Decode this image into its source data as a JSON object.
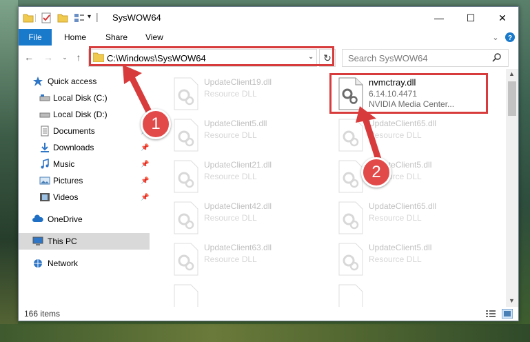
{
  "window": {
    "title": "SysWOW64",
    "controls": {
      "minimize": "—",
      "maximize": "☐",
      "close": "✕"
    }
  },
  "ribbon": {
    "tabs": [
      "File",
      "Home",
      "Share",
      "View"
    ]
  },
  "address_bar": {
    "path": "C:\\Windows\\SysWOW64",
    "refresh_icon": "refresh-icon"
  },
  "search": {
    "placeholder": "Search SysWOW64"
  },
  "sidebar": {
    "items": [
      {
        "label": "Quick access",
        "icon": "star-icon"
      },
      {
        "label": "Local Disk (C:)",
        "icon": "drive-icon"
      },
      {
        "label": "Local Disk (D:)",
        "icon": "drive-icon"
      },
      {
        "label": "Documents",
        "icon": "documents-icon"
      },
      {
        "label": "Downloads",
        "icon": "downloads-icon"
      },
      {
        "label": "Music",
        "icon": "music-icon"
      },
      {
        "label": "Pictures",
        "icon": "pictures-icon"
      },
      {
        "label": "Videos",
        "icon": "videos-icon"
      },
      {
        "label": "OneDrive",
        "icon": "cloud-icon"
      },
      {
        "label": "This PC",
        "icon": "computer-icon"
      },
      {
        "label": "Network",
        "icon": "network-icon"
      }
    ]
  },
  "files": {
    "highlighted": {
      "name": "nvmctray.dll",
      "version": "6.14.10.4471",
      "description": "NVIDIA Media Center..."
    },
    "left_column": [
      {
        "name": "UpdateClient19.dll",
        "type": "Resource DLL"
      },
      {
        "name": "UpdateClient5.dll",
        "type": "Resource DLL"
      },
      {
        "name": "UpdateClient21.dll",
        "type": "Resource DLL"
      },
      {
        "name": "UpdateClient42.dll",
        "type": "Resource DLL"
      },
      {
        "name": "UpdateClient63.dll",
        "type": "Resource DLL"
      }
    ],
    "right_column": [
      {
        "name": "UpdateClient65.dll",
        "type": "Resource DLL"
      },
      {
        "name": "UpdateClient5.dll",
        "type": "Resource DLL"
      },
      {
        "name": "UpdateClient65.dll",
        "type": "Resource DLL"
      },
      {
        "name": "UpdateClient5.dll",
        "type": "Resource DLL"
      }
    ]
  },
  "status": {
    "item_count": "166 items"
  },
  "annotations": {
    "step1": "1",
    "step2": "2",
    "color": "#d83b3b"
  }
}
